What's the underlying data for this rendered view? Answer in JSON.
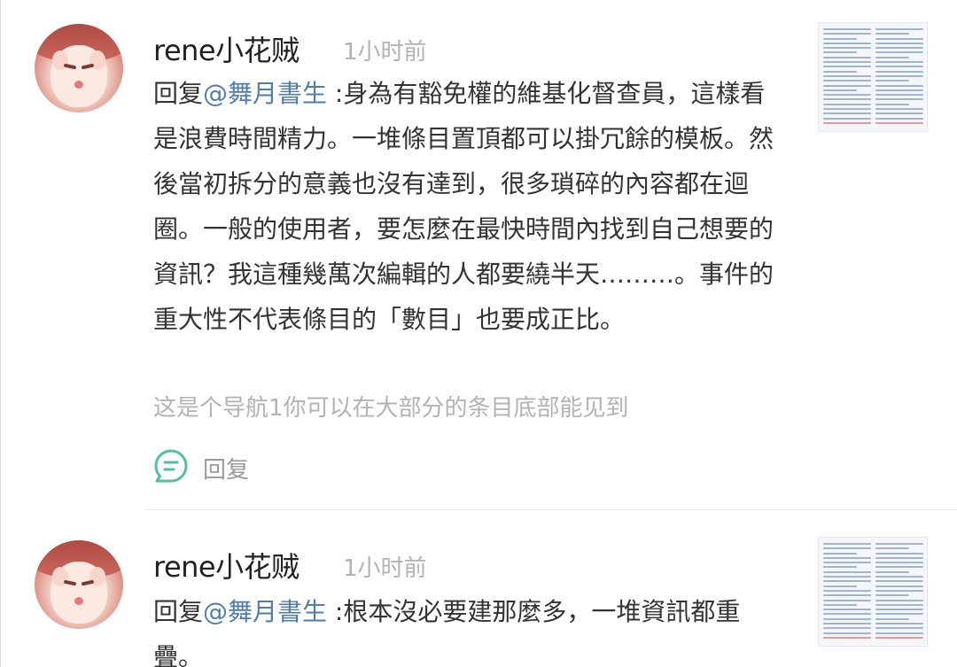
{
  "comments": [
    {
      "username": "rene小花贼",
      "time": "1小时前",
      "reply_prefix": "回复",
      "mention": "@舞月書生",
      "text": " :身為有豁免權的維基化督查員，這樣看是浪費時間精力。一堆條目置頂都可以掛冗餘的模板。然後當初拆分的意義也沒有達到，很多瑣碎的內容都在迴圈。一般的使用者，要怎麼在最快時間內找到自己想要的資訊？我這種幾萬次編輯的人都要繞半天………。事件的重大性不代表條目的「數目」也要成正比。",
      "translation_note": "这是个导航1你可以在大部分的条目底部能见到",
      "reply_label": "回复",
      "avatar_icon": "anime-character-avatar",
      "thumbnail_icon": "navigation-template-thumbnail"
    },
    {
      "username": "rene小花贼",
      "time": "1小时前",
      "reply_prefix": "回复",
      "mention": "@舞月書生",
      "text": " :根本沒必要建那麼多，一堆資訊都重疊。",
      "avatar_icon": "anime-character-avatar",
      "thumbnail_icon": "navigation-template-thumbnail"
    }
  ],
  "colors": {
    "mention": "#507daf",
    "reply_icon": "#4fc0a0",
    "muted_text": "#b3b3b3",
    "divider": "#e8e8e8"
  }
}
